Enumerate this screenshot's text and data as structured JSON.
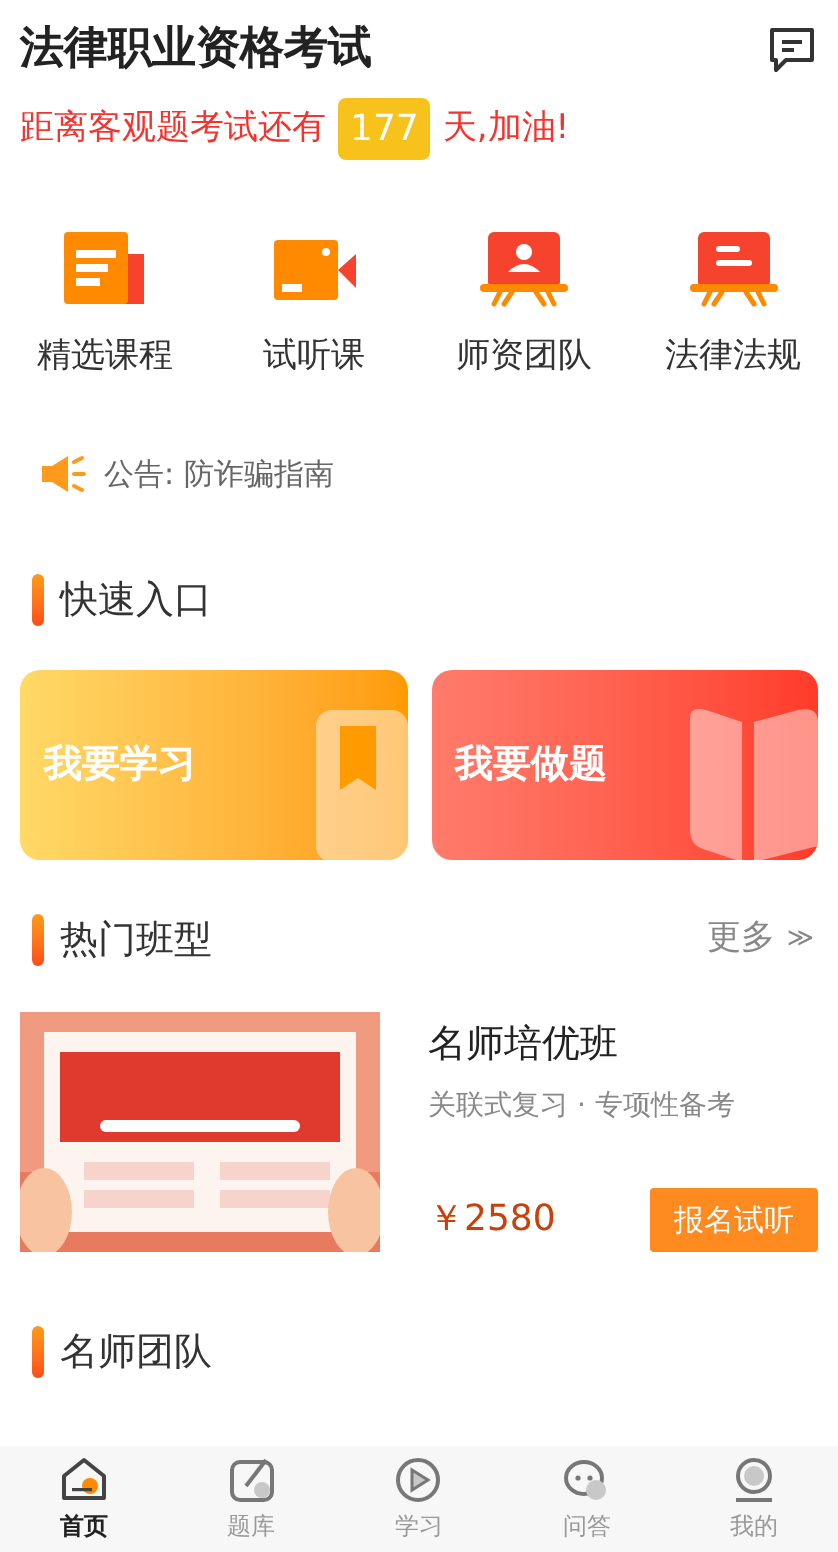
{
  "header": {
    "title": "法律职业资格考试"
  },
  "countdown": {
    "before": "距离客观题考试还有",
    "days": "177",
    "after": "天,加油!"
  },
  "shortcuts": [
    {
      "label": "精选课程",
      "kind": "course"
    },
    {
      "label": "试听课",
      "kind": "video"
    },
    {
      "label": "师资团队",
      "kind": "teacher"
    },
    {
      "label": "法律法规",
      "kind": "law"
    }
  ],
  "notice": {
    "text": "公告: 防诈骗指南"
  },
  "quick_entry": {
    "title": "快速入口",
    "cards": [
      {
        "label": "我要学习",
        "kind": "study"
      },
      {
        "label": "我要做题",
        "kind": "practice"
      }
    ]
  },
  "hot_classes": {
    "title": "热门班型",
    "more": "更多",
    "more_icon": "≫",
    "course": {
      "name": "名师培优班",
      "subtitle": "关联式复习 · 专项性备考",
      "price": "￥2580",
      "button": "报名试听"
    }
  },
  "teachers": {
    "title": "名师团队"
  },
  "tab_bar": [
    {
      "label": "首页",
      "kind": "home",
      "selected": true
    },
    {
      "label": "题库",
      "kind": "bank",
      "selected": false
    },
    {
      "label": "学习",
      "kind": "play",
      "selected": false
    },
    {
      "label": "问答",
      "kind": "chat",
      "selected": false
    },
    {
      "label": "我的",
      "kind": "me",
      "selected": false
    }
  ]
}
